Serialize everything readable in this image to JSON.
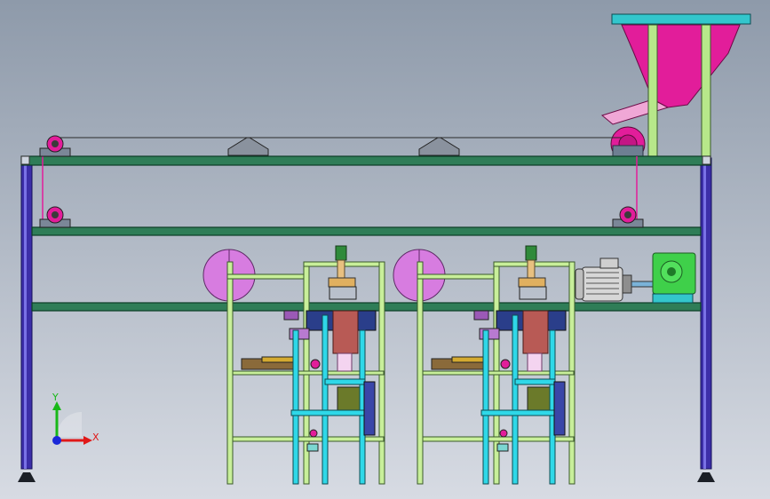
{
  "viewport": {
    "background_top": "#8e9aaa",
    "background_bottom": "#d7dbe3"
  },
  "colors": {
    "beam_green": "#2f7d57",
    "beam_edge": "#0b3c26",
    "post_blue": "#3c2ea8",
    "post_light": "#7a72e6",
    "frame_lime": "#c8ef9a",
    "frame_edge": "#3a5a2a",
    "cyan": "#2fd8e8",
    "magenta": "#e21d9a",
    "pink_roll": "#d77ce0",
    "motor_green": "#3fd04a",
    "motor_grey": "#d7d7d7",
    "hopper_top": "#33c6cc"
  },
  "triad": {
    "x_label": "X",
    "y_label": "Y",
    "x_color": "#e01818",
    "y_color": "#18b818",
    "z_color": "#1a28d8"
  }
}
